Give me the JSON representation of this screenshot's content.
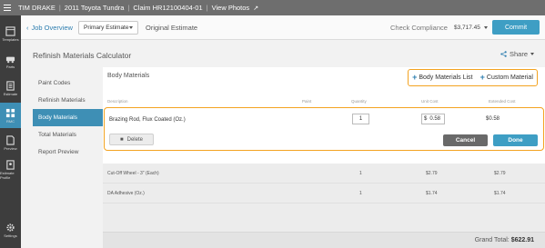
{
  "topbar": {
    "owner": "TIM DRAKE",
    "vehicle": "2011 Toyota Tundra",
    "claim": "Claim HR12100404-01",
    "photos": "View Photos"
  },
  "leftbar": {
    "items": [
      {
        "label": "Templates",
        "icon": "templates-icon"
      },
      {
        "label": "Parts",
        "icon": "car-parts-icon"
      },
      {
        "label": "Estimate",
        "icon": "estimate-icon"
      },
      {
        "label": "RMC",
        "icon": "calculator-icon"
      },
      {
        "label": "Preview",
        "icon": "preview-icon"
      },
      {
        "label": "Estimate Profile",
        "icon": "profile-icon"
      },
      {
        "label": "Settings",
        "icon": "gear-icon"
      }
    ]
  },
  "subbar": {
    "back_label": "Job Overview",
    "estimate_select": "Primary Estimate",
    "estimate_name": "Original Estimate",
    "check_compliance": "Check Compliance",
    "total": "$3,717.45",
    "commit": "Commit"
  },
  "panel": {
    "title": "Refinish Materials Calculator",
    "share": "Share"
  },
  "calc_nav": [
    {
      "label": "Paint Codes",
      "active": false
    },
    {
      "label": "Refinish Materials",
      "active": false
    },
    {
      "label": "Body Materials",
      "active": true
    },
    {
      "label": "Total Materials",
      "active": false
    },
    {
      "label": "Report Preview",
      "active": false
    }
  ],
  "card": {
    "title": "Body Materials",
    "body_materials_list": "Body Materials List",
    "custom_material": "Custom Material",
    "columns": {
      "description": "Description",
      "paint": "Paint",
      "quantity": "Quantity",
      "unit_cost": "Unit Cost",
      "extended_cost": "Extended Cost"
    },
    "edit_row": {
      "description": "Brazing Rod, Flux Coated (Oz.)",
      "quantity": "1",
      "currency": "$",
      "unit_cost": "0.58",
      "extended_cost": "$0.58",
      "delete": "Delete",
      "cancel": "Cancel",
      "done": "Done"
    },
    "rows": [
      {
        "description": "Cut-Off Wheel - 3\" (Each)",
        "quantity": "1",
        "unit_cost": "$2.79",
        "extended_cost": "$2.79"
      },
      {
        "description": "DA Adhesive (Oz.)",
        "quantity": "1",
        "unit_cost": "$1.74",
        "extended_cost": "$1.74"
      }
    ],
    "grand_total_label": "Grand Total:",
    "grand_total": "$622.91"
  },
  "colors": {
    "accent": "#3e8fb5",
    "highlight": "#f3a321",
    "topbar": "#6e6e6e"
  }
}
